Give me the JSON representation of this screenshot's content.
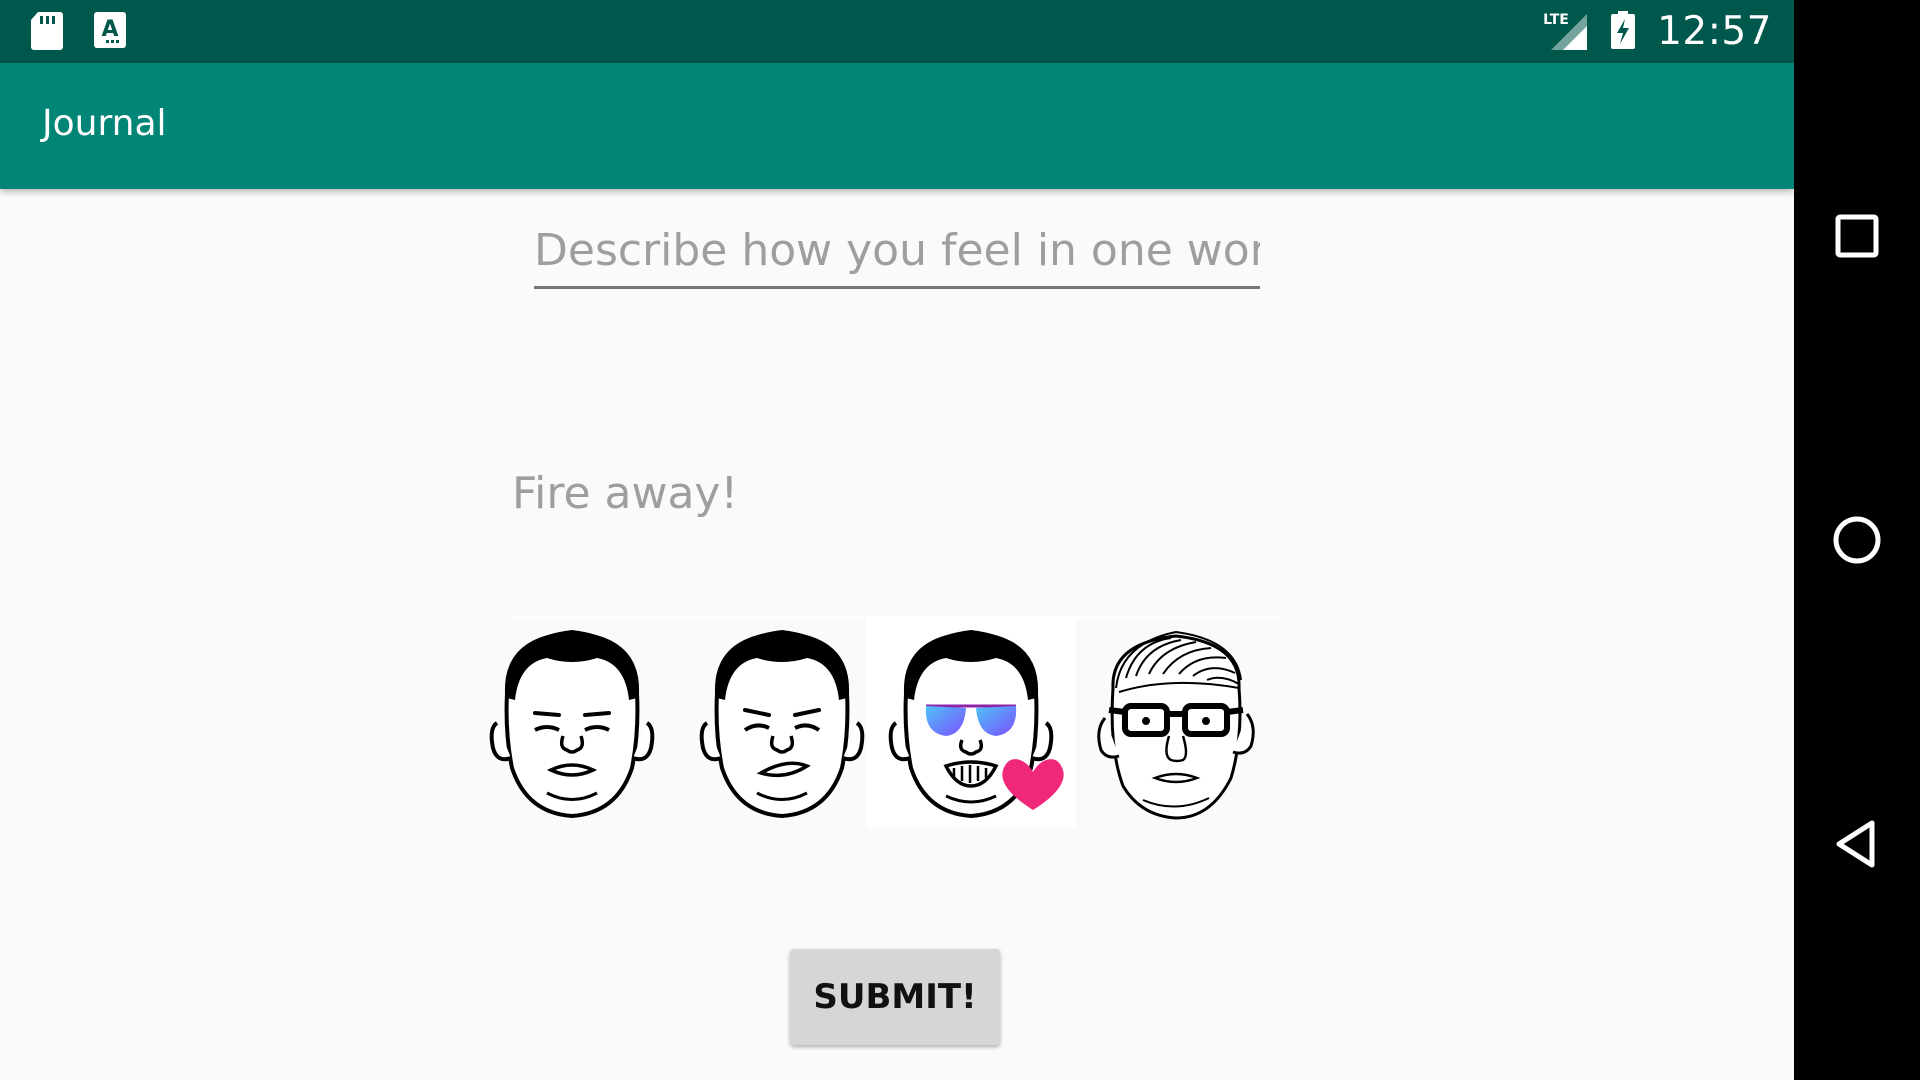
{
  "status_bar": {
    "time": "12:57",
    "network": "LTE",
    "icons": [
      "sd-card-icon",
      "keyboard-a-icon",
      "signal-icon",
      "battery-charging-icon"
    ]
  },
  "app_bar": {
    "title": "Journal"
  },
  "form": {
    "mood_placeholder": "Describe how you feel in one word.",
    "mood_value": "",
    "entry_placeholder": "Fire away!",
    "entry_value": ""
  },
  "emojis": [
    {
      "name": "neutral-face",
      "selected": false
    },
    {
      "name": "smirk-face",
      "selected": false
    },
    {
      "name": "sunglasses-heart-face",
      "selected": true
    },
    {
      "name": "realistic-glasses-face",
      "selected": false
    }
  ],
  "submit": {
    "label": "SUBMIT!"
  },
  "nav_bar": {
    "buttons": [
      "recents-icon",
      "home-icon",
      "back-icon"
    ]
  },
  "colors": {
    "status_bar": "#00574b",
    "app_bar": "#008577",
    "background": "#fafafa",
    "button": "#d6d6d6",
    "heart": "#f0287a"
  }
}
